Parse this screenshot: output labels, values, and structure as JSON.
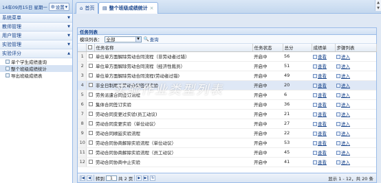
{
  "left": {
    "date": "14年09月15日 星期一",
    "settings_label": "设置",
    "menus": [
      {
        "label": "系统菜单"
      },
      {
        "label": "教师管理"
      },
      {
        "label": "用户管理"
      },
      {
        "label": "实验管理"
      },
      {
        "label": "实验评分"
      }
    ],
    "sub_items": [
      {
        "label": "单个学生成绩查询"
      },
      {
        "label": "整个班级成绩统计"
      },
      {
        "label": "导出班级成绩表"
      }
    ]
  },
  "tabs": [
    {
      "label": "首页"
    },
    {
      "label": "整个班级成绩统计"
    }
  ],
  "panel": {
    "title": "任务列表",
    "category_label": "模块列表：",
    "category_value": "全部",
    "search_label": "查询"
  },
  "columns": [
    "任务名称",
    "任务状态",
    "总分",
    "成绩单",
    "步骤列表"
  ],
  "rows": [
    {
      "n": "1",
      "name": "单位单方面解除劳动合同流程（非劳动者过错）",
      "status": "开启中",
      "score": "56",
      "view": "查看",
      "enter": "进入"
    },
    {
      "n": "2",
      "name": "单位单方面解除劳动合同流程（经济性裁员）",
      "status": "开启中",
      "score": "51",
      "view": "查看",
      "enter": "进入"
    },
    {
      "n": "3",
      "name": "单位单方面解除劳动合同流程(劳动者过错)",
      "status": "开启中",
      "score": "49",
      "view": "查看",
      "enter": "进入"
    },
    {
      "n": "4",
      "name": "非全日制用工劳动合同签订实验",
      "status": "开启中",
      "score": "20",
      "view": "查看",
      "enter": "进入"
    },
    {
      "n": "5",
      "name": "劳务派遣合同签订流程",
      "status": "开启中",
      "score": "6",
      "view": "查看",
      "enter": "进入"
    },
    {
      "n": "6",
      "name": "集体合同签订实验",
      "status": "开启中",
      "score": "36",
      "view": "查看",
      "enter": "进入"
    },
    {
      "n": "7",
      "name": "劳动合同变更过实验(员工动议)",
      "status": "开启中",
      "score": "21",
      "view": "查看",
      "enter": "进入"
    },
    {
      "n": "8",
      "name": "劳动合同变更实验（单位动议）",
      "status": "开启中",
      "score": "27",
      "view": "查看",
      "enter": "进入"
    },
    {
      "n": "9",
      "name": "劳动合同顺延实验流程",
      "status": "开启中",
      "score": "22",
      "view": "查看",
      "enter": "进入"
    },
    {
      "n": "10",
      "name": "劳动合同协商解除实验流程（单位动议）",
      "status": "开启中",
      "score": "53",
      "view": "查看",
      "enter": "进入"
    },
    {
      "n": "11",
      "name": "劳动合同协商解除实验流程（员工动议）",
      "status": "开启中",
      "score": "45",
      "view": "查看",
      "enter": "进入"
    },
    {
      "n": "12",
      "name": "劳动合同协商中止实验",
      "status": "开启中",
      "score": "41",
      "view": "查看",
      "enter": "进入"
    }
  ],
  "footer": {
    "goto_label": "转到",
    "page_value": "1",
    "page_total": "共 2 页",
    "range_info": "显示 1 - 12，共 20 条"
  },
  "watermark": "实验作业类型列表"
}
